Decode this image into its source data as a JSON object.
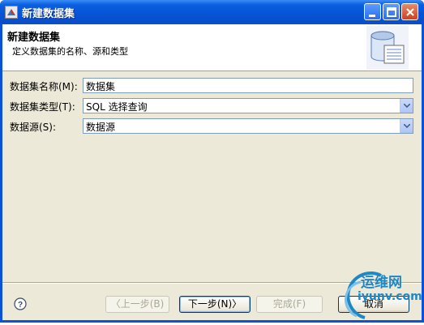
{
  "window": {
    "title": "新建数据集"
  },
  "banner": {
    "title": "新建数据集",
    "description": "定义数据集的名称、源和类型"
  },
  "form": {
    "name_label": "数据集名称(M):",
    "name_value": "数据集",
    "type_label": "数据集类型(T):",
    "type_value": "SQL 选择查询",
    "source_label": "数据源(S):",
    "source_value": "数据源"
  },
  "buttons": {
    "back": "〈上一步(B)",
    "next": "下一步(N)〉",
    "finish": "完成(F)",
    "cancel": "取消"
  },
  "watermark": {
    "line1": "运维网",
    "line2": "iyunv.com"
  }
}
